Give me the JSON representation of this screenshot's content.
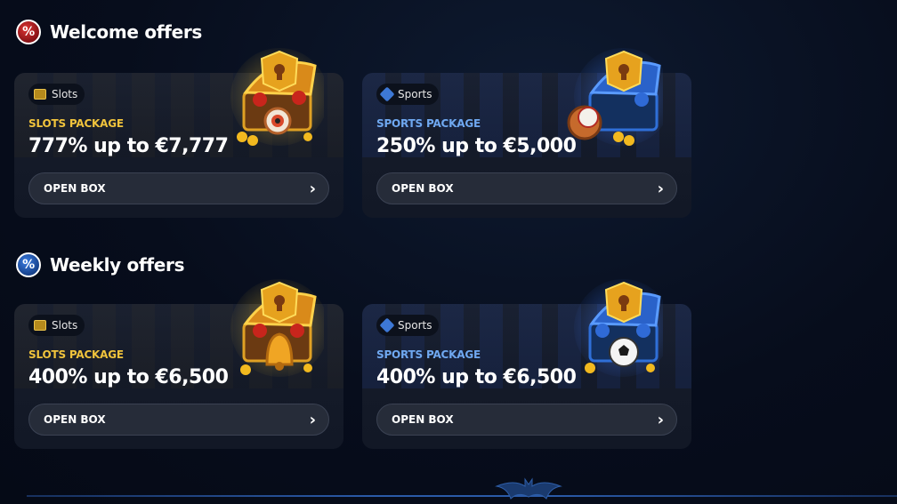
{
  "sections": [
    {
      "title": "Welcome offers",
      "cards": [
        {
          "tag": "Slots",
          "package": "SLOTS PACKAGE",
          "amount": "777% up to €7,777",
          "button": "OPEN BOX"
        },
        {
          "tag": "Sports",
          "package": "SPORTS PACKAGE",
          "amount": "250% up to €5,000",
          "button": "OPEN BOX"
        }
      ]
    },
    {
      "title": "Weekly offers",
      "cards": [
        {
          "tag": "Slots",
          "package": "SLOTS PACKAGE",
          "amount": "400% up to €6,500",
          "button": "OPEN BOX"
        },
        {
          "tag": "Sports",
          "package": "SPORTS PACKAGE",
          "amount": "400% up to €6,500",
          "button": "OPEN BOX"
        }
      ]
    }
  ],
  "icons": {
    "section_welcome": "percent-badge-icon",
    "section_weekly": "percent-badge-icon",
    "slots_tag": "slots-icon",
    "sports_tag": "sports-icon",
    "button_arrow": "chevron-right-icon"
  },
  "colors": {
    "slots_accent": "#f0c33c",
    "sports_accent": "#6fa8f0",
    "card_bg": "#161c2a",
    "button_bg": "#262c39",
    "page_bg": "#070d1c"
  }
}
